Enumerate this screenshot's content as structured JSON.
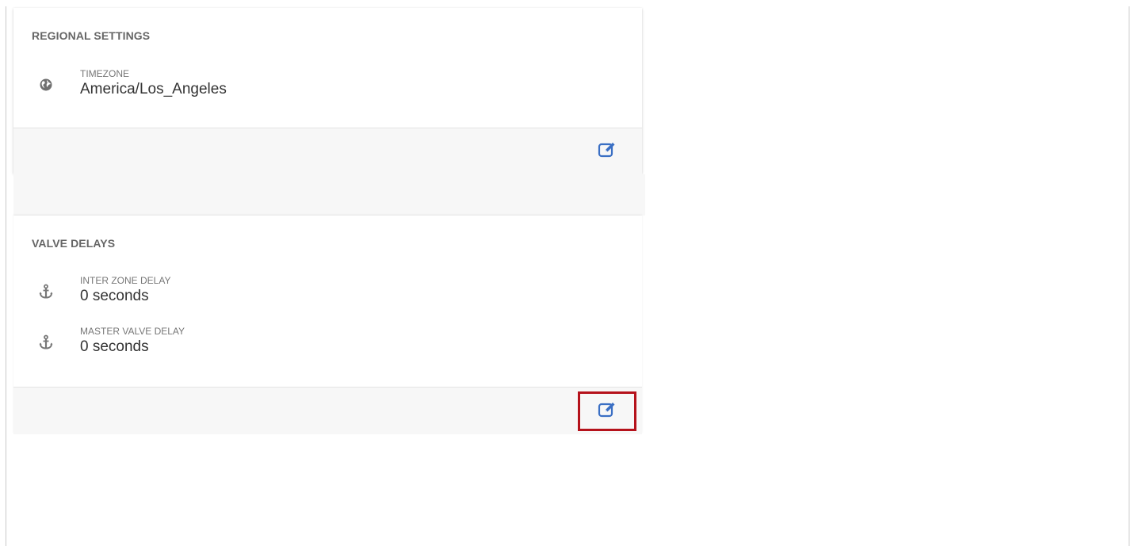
{
  "regional": {
    "title": "REGIONAL SETTINGS",
    "timezone": {
      "label": "TIMEZONE",
      "value": "America/Los_Angeles",
      "icon": "globe-icon"
    },
    "edit_icon": "edit-icon"
  },
  "valve": {
    "title": "VALVE DELAYS",
    "inter_zone": {
      "label": "INTER ZONE DELAY",
      "value": "0 seconds",
      "icon": "anchor-icon"
    },
    "master_valve": {
      "label": "MASTER VALVE DELAY",
      "value": "0 seconds",
      "icon": "anchor-icon"
    },
    "edit_icon": "edit-icon"
  },
  "colors": {
    "accent": "#3a6fc4",
    "highlight": "#b5121b",
    "icon_gray": "#777777"
  }
}
